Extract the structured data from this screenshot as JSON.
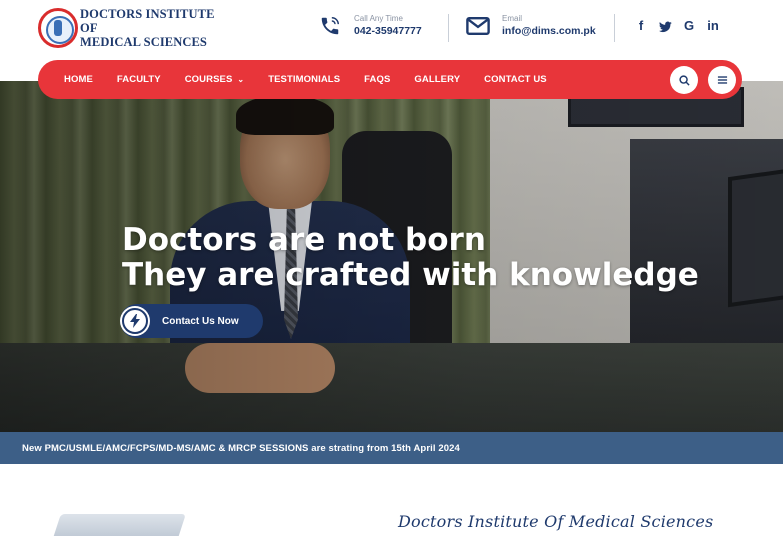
{
  "header": {
    "logo_text_line1": "DOCTORS INSTITUTE OF",
    "logo_text_line2": "MEDICAL SCIENCES",
    "phone_label": "Call Any Time",
    "phone_value": "042-35947777",
    "email_label": "Email",
    "email_value": "info@dims.com.pk",
    "social": [
      "f",
      "t",
      "G",
      "in"
    ]
  },
  "nav": {
    "items": [
      "HOME",
      "FACULTY",
      "COURSES",
      "TESTIMONIALS",
      "FAQS",
      "GALLERY",
      "CONTACT US"
    ],
    "courses_caret": "⌄"
  },
  "hero": {
    "title_line1": "Doctors are not born",
    "title_line2": "They are crafted with knowledge",
    "cta_label": "Contact Us Now"
  },
  "ticker": {
    "text": "New PMC/USMLE/AMC/FCPS/MD-MS/AMC & MRCP SESSIONS are strating from 15th April 2024"
  },
  "about": {
    "script_title": "Doctors Institute Of Medical Sciences"
  },
  "colors": {
    "nav_red": "#e8353a",
    "navy": "#1f3a6d",
    "ticker_blue": "#3d5f87"
  }
}
